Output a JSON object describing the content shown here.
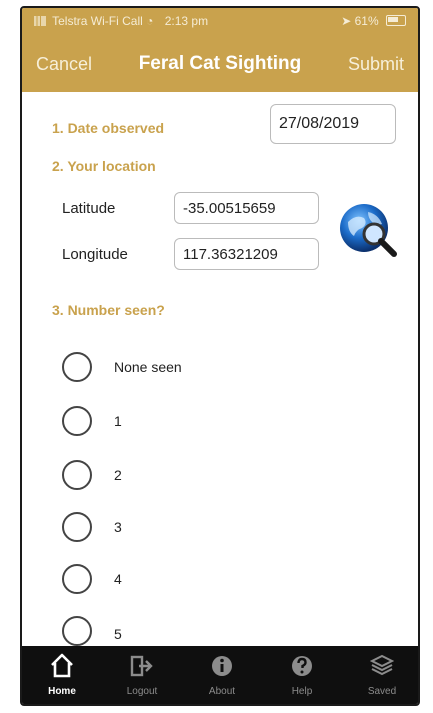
{
  "status_bar": {
    "carrier": "Telstra Wi-Fi Call",
    "time": "2:13 pm",
    "battery": "61%"
  },
  "nav": {
    "cancel_label": "Cancel",
    "title": "Feral Cat Sighting",
    "submit_label": "Submit"
  },
  "form": {
    "date_section": "1. Date observed",
    "date_value": "27/08/2019",
    "location_section": "2. Your location",
    "latitude_label": "Latitude",
    "latitude_value": "-35.00515659",
    "longitude_label": "Longitude",
    "longitude_value": "117.36321209",
    "number_section": "3. Number seen?",
    "options": [
      "None seen",
      "1",
      "2",
      "3",
      "4",
      "5"
    ]
  },
  "tabs": [
    {
      "label": "Home",
      "icon": "home-icon",
      "active": true
    },
    {
      "label": "Logout",
      "icon": "logout-icon",
      "active": false
    },
    {
      "label": "About",
      "icon": "info-icon",
      "active": false
    },
    {
      "label": "Help",
      "icon": "help-icon",
      "active": false
    },
    {
      "label": "Saved",
      "icon": "saved-layers-icon",
      "active": false
    }
  ],
  "colors": {
    "brand_gold": "#c9a24d",
    "tab_bar": "#0f0f0f"
  }
}
